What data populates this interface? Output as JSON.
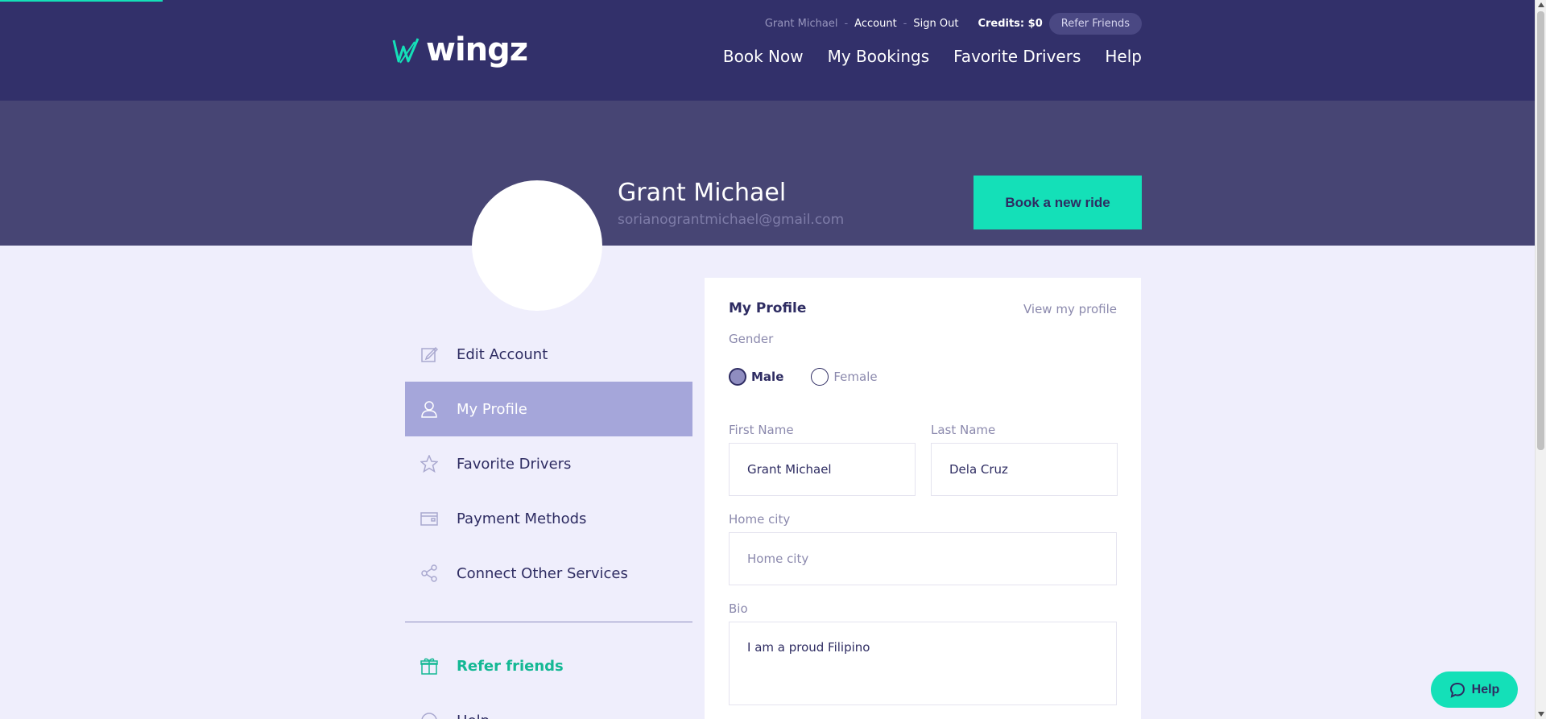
{
  "brand": {
    "name": "wingz",
    "accent": "#14e0b8",
    "header_bg": "#32306a",
    "hero_bg": "#474574"
  },
  "topbar": {
    "user_name": "Grant Michael",
    "sep1": "-",
    "account_label": "Account",
    "sep2": "-",
    "sign_out_label": "Sign Out",
    "credits_label": "Credits: $0",
    "refer_label": "Refer Friends"
  },
  "nav": {
    "book_now": "Book Now",
    "my_bookings": "My Bookings",
    "favorite_drivers": "Favorite Drivers",
    "help": "Help"
  },
  "profile": {
    "name": "Grant Michael",
    "email": "sorianograntmichael@gmail.com",
    "book_ride_label": "Book a new ride"
  },
  "sidebar": {
    "items": [
      {
        "label": "Edit Account",
        "icon": "edit-icon"
      },
      {
        "label": "My Profile",
        "icon": "user-icon",
        "active": true
      },
      {
        "label": "Favorite Drivers",
        "icon": "star-icon"
      },
      {
        "label": "Payment Methods",
        "icon": "wallet-icon"
      },
      {
        "label": "Connect Other Services",
        "icon": "share-icon"
      }
    ],
    "refer_label": "Refer friends",
    "help_label": "Help"
  },
  "card": {
    "title": "My Profile",
    "view_link": "View my profile",
    "gender_label": "Gender",
    "gender_options": [
      "Male",
      "Female"
    ],
    "gender_selected": "Male",
    "first_name_label": "First Name",
    "first_name_value": "Grant Michael",
    "last_name_label": "Last Name",
    "last_name_value": "Dela Cruz",
    "home_city_label": "Home city",
    "home_city_placeholder": "Home city",
    "home_city_value": "",
    "bio_label": "Bio",
    "bio_value": "I am a proud Filipino"
  },
  "help_fab": {
    "label": "Help"
  }
}
